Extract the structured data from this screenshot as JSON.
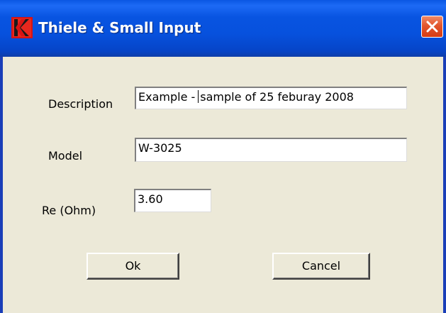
{
  "window": {
    "title": "Thiele & Small Input",
    "app_icon": "red-k-logo-icon",
    "close_icon": "close-x-icon",
    "titlebar_color": "#0752dd",
    "close_color": "#e2562e",
    "background_color": "#ece9d8"
  },
  "form": {
    "description": {
      "label": "Description",
      "value_before_caret": "Example -",
      "value_after_caret": "sample of 25 feburay 2008"
    },
    "model": {
      "label": "Model",
      "value": "W-3025"
    },
    "re": {
      "label": "Re (Ohm)",
      "value": "3.60"
    }
  },
  "buttons": {
    "ok_label": "Ok",
    "cancel_label": "Cancel"
  }
}
